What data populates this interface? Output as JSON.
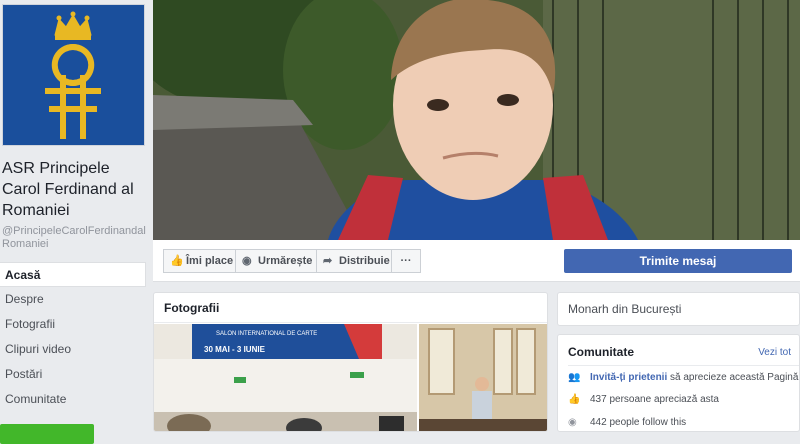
{
  "page": {
    "name": "ASR Principele Carol Ferdinand al Romaniei",
    "handle": "@PrincipeleCarolFerdinandalRomaniei"
  },
  "nav": {
    "items": [
      {
        "label": "Acasă",
        "active": true
      },
      {
        "label": "Despre"
      },
      {
        "label": "Fotografii"
      },
      {
        "label": "Clipuri video"
      },
      {
        "label": "Postări"
      },
      {
        "label": "Comunitate"
      }
    ]
  },
  "actions": {
    "like": "Îmi place",
    "follow": "Urmărește",
    "share": "Distribuie",
    "more": "···",
    "send_message": "Trimite mesaj"
  },
  "photos": {
    "title": "Fotografii",
    "banner_text": "SALON INTERNATIONAL DE CARTE",
    "banner_dates": "30 MAI - 3 IUNIE"
  },
  "about": {
    "category": "Monarh din București"
  },
  "community": {
    "title": "Comunitate",
    "see_all": "Vezi tot",
    "invite_link": "Invită-ți prietenii",
    "invite_text": " să aprecieze această Pagină",
    "likes": "437 persoane apreciază asta",
    "follows": "442 people follow this"
  },
  "colors": {
    "brand": "#4267b2",
    "logo_bg": "#1a4f9c",
    "logo_gold": "#e8b823",
    "green": "#42b72a"
  },
  "icons": [
    "thumbs-up-icon",
    "rss-icon",
    "share-arrow-icon",
    "more-icon",
    "people-icon",
    "thumbs-up-small-icon",
    "rss-small-icon"
  ]
}
